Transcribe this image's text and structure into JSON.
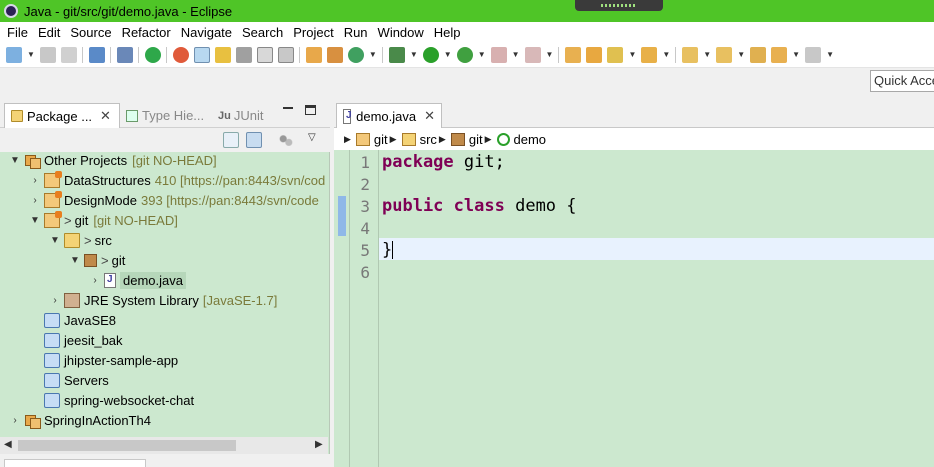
{
  "window": {
    "title": "Java - git/src/git/demo.java - Eclipse",
    "title_bar_color": "#4fc527"
  },
  "menu": [
    "File",
    "Edit",
    "Source",
    "Refactor",
    "Navigate",
    "Search",
    "Project",
    "Run",
    "Window",
    "Help"
  ],
  "quick_access": "Quick Access",
  "left_view": {
    "tabs": {
      "package_explorer": "Package ...",
      "type_hierarchy": "Type Hie...",
      "junit": "JUnit"
    },
    "tree": {
      "other_projects": {
        "label": "Other Projects",
        "decoration": "[git NO-HEAD]"
      },
      "data_structures": {
        "label": "DataStructures",
        "decoration": "410 [https://pan:8443/svn/cod"
      },
      "design_mode": {
        "label": "DesignMode",
        "decoration": "393 [https://pan:8443/svn/code"
      },
      "git_project": {
        "prefix": ">",
        "label": "git",
        "decoration": "[git NO-HEAD]"
      },
      "src_folder": {
        "prefix": ">",
        "label": "src"
      },
      "git_package": {
        "prefix": ">",
        "label": "git"
      },
      "demo_java": {
        "label": "demo.java"
      },
      "jre_library": {
        "label": "JRE System Library",
        "decoration": "[JavaSE-1.7]"
      },
      "javase8": {
        "label": "JavaSE8"
      },
      "jeesit_bak": {
        "label": "jeesit_bak"
      },
      "jhipster": {
        "label": "jhipster-sample-app"
      },
      "servers": {
        "label": "Servers"
      },
      "spring_chat": {
        "label": "spring-websocket-chat"
      },
      "spring_in_action": {
        "label": "SpringInActionTh4"
      }
    }
  },
  "editor": {
    "tab_label": "demo.java",
    "breadcrumb": [
      "git",
      "src",
      "git",
      "demo"
    ],
    "line_numbers": [
      "1",
      "2",
      "3",
      "4",
      "5",
      "6"
    ],
    "code": {
      "line1_kw": "package",
      "line1_rest": " git;",
      "line3_kw1": "public",
      "line3_kw2": "class",
      "line3_rest": " demo {",
      "line5": "}"
    },
    "keyword_color": "#7f0055",
    "background_color": "#cce8cf"
  }
}
